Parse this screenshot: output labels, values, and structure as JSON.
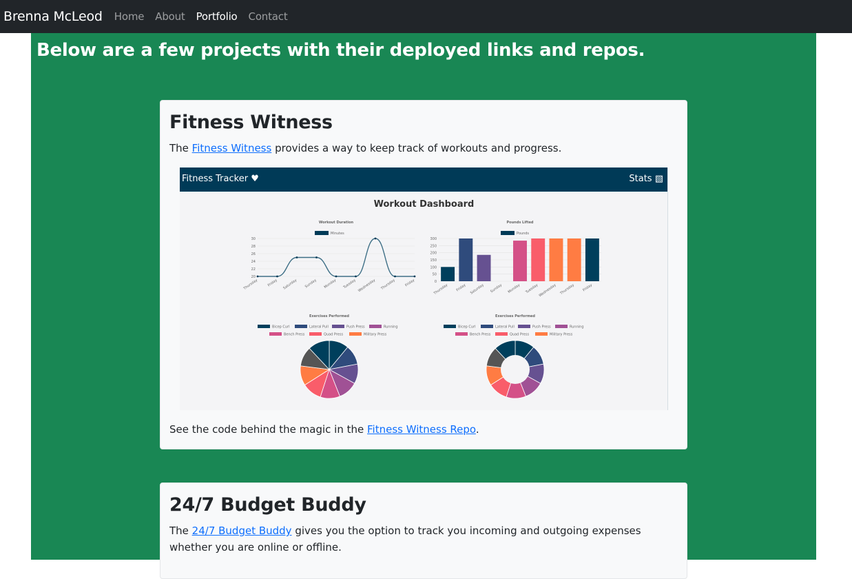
{
  "navbar": {
    "brand": "Brenna McLeod",
    "links": [
      "Home",
      "About",
      "Portfolio",
      "Contact"
    ],
    "active": "Portfolio"
  },
  "page": {
    "heading": "Below are a few projects with their deployed links and repos."
  },
  "projects": [
    {
      "title": "Fitness Witness",
      "description_prefix": "The ",
      "link_text": "Fitness Witness",
      "description_suffix": " provides a way to keep track of workouts and progress.",
      "repo_prefix": "See the code behind the magic in the ",
      "repo_link_text": "Fitness Witness Repo",
      "repo_suffix": "."
    },
    {
      "title": "24/7 Budget Buddy",
      "description_prefix": "The ",
      "link_text": "24/7 Budget Buddy",
      "description_suffix": " gives you the option to track you incoming and outgoing expenses whether you are online or offline."
    }
  ],
  "screenshot": {
    "app_title": "Fitness Tracker",
    "stats_label": "Stats",
    "dashboard_title": "Workout Dashboard",
    "colors": {
      "header": "#003a57",
      "palette": [
        "#003f5c",
        "#2f4b7c",
        "#665191",
        "#a05195",
        "#d45087",
        "#f95d6a",
        "#ff7c43",
        "#ffa600"
      ]
    },
    "chart_data": [
      {
        "type": "line",
        "title": "Workout Duration",
        "legend": [
          "Minutes"
        ],
        "categories": [
          "Thursday",
          "Friday",
          "Saturday",
          "Sunday",
          "Monday",
          "Tuesday",
          "Wednesday",
          "Thursday",
          "Friday"
        ],
        "series": [
          {
            "name": "Minutes",
            "values": [
              20,
              20,
              25,
              25,
              20,
              20,
              30,
              20,
              20
            ]
          }
        ],
        "yticks": [
          "30",
          "28",
          "26",
          "24",
          "22",
          "20"
        ],
        "ylim": [
          20,
          30
        ]
      },
      {
        "type": "bar",
        "title": "Pounds Lifted",
        "legend": [
          "Pounds"
        ],
        "categories": [
          "Thursday",
          "Friday",
          "Saturday",
          "Sunday",
          "Monday",
          "Tuesday",
          "Wednesday",
          "Thursday",
          "Friday"
        ],
        "series": [
          {
            "name": "Pounds",
            "values": [
              100,
              300,
              185,
              0,
              285,
              300,
              300,
              300,
              300
            ]
          }
        ],
        "bar_colors": [
          "#003f5c",
          "#2f4b7c",
          "#665191",
          "#a05195",
          "#d45087",
          "#f95d6a",
          "#ff7c43",
          "#ff7c43",
          "#003f5c"
        ],
        "yticks": [
          "300",
          "250",
          "200",
          "150",
          "100",
          "50",
          "0"
        ],
        "ylim": [
          0,
          300
        ]
      },
      {
        "type": "pie",
        "title": "Exercises Performed",
        "legend": [
          "Bicep Curl",
          "Lateral Pull",
          "Push Press",
          "Running",
          "Bench Press",
          "Quad Press",
          "Military Press"
        ],
        "values": [
          11,
          11,
          11,
          11,
          11,
          11,
          11,
          11,
          12
        ],
        "slice_colors": [
          "#003f5c",
          "#2f4b7c",
          "#665191",
          "#a05195",
          "#d45087",
          "#f95d6a",
          "#ff7c43",
          "#555555",
          "#003f5c"
        ]
      },
      {
        "type": "pie",
        "title": "Exercises Performed",
        "legend": [
          "Bicep Curl",
          "Lateral Pull",
          "Push Press",
          "Running",
          "Bench Press",
          "Quad Press",
          "Military Press"
        ],
        "values": [
          11,
          11,
          11,
          11,
          11,
          11,
          11,
          11,
          12
        ],
        "slice_colors": [
          "#003f5c",
          "#2f4b7c",
          "#665191",
          "#a05195",
          "#d45087",
          "#f95d6a",
          "#ff7c43",
          "#555555",
          "#003f5c"
        ],
        "donut": true
      }
    ]
  }
}
